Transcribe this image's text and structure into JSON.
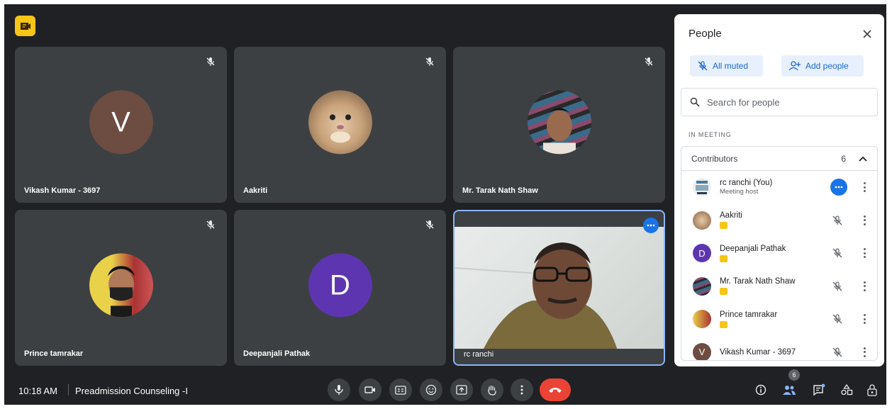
{
  "tiles": [
    {
      "name": "Vikash Kumar - 3697",
      "initial": "V",
      "avatar_color": "#6d4c41"
    },
    {
      "name": "Aakriti"
    },
    {
      "name": "Mr. Tarak Nath Shaw"
    },
    {
      "name": "Prince tamrakar"
    },
    {
      "name": "Deepanjali Pathak",
      "initial": "D",
      "avatar_color": "#5e35b1"
    },
    {
      "name": "rc ranchi"
    }
  ],
  "panel": {
    "title": "People",
    "all_muted_label": "All muted",
    "add_people_label": "Add people",
    "search_placeholder": "Search for people",
    "section_label": "IN MEETING",
    "contributors_label": "Contributors",
    "contributors_count": "6",
    "people": [
      {
        "name": "rc ranchi (You)",
        "sub": "Meeting host"
      },
      {
        "name": "Aakriti"
      },
      {
        "name": "Deepanjali Pathak",
        "initial": "D"
      },
      {
        "name": "Mr. Tarak Nath Shaw"
      },
      {
        "name": "Prince tamrakar"
      },
      {
        "name": "Vikash Kumar - 3697",
        "initial": "V"
      }
    ]
  },
  "bottom": {
    "time": "10:18 AM",
    "meeting_title": "Preadmission Counseling -I",
    "people_count": "6"
  },
  "colors": {
    "background": "#202124",
    "tile": "#3c4043",
    "accent": "#1a73e8",
    "hangup": "#ea4335",
    "chip_bg": "#e8f0fe"
  }
}
